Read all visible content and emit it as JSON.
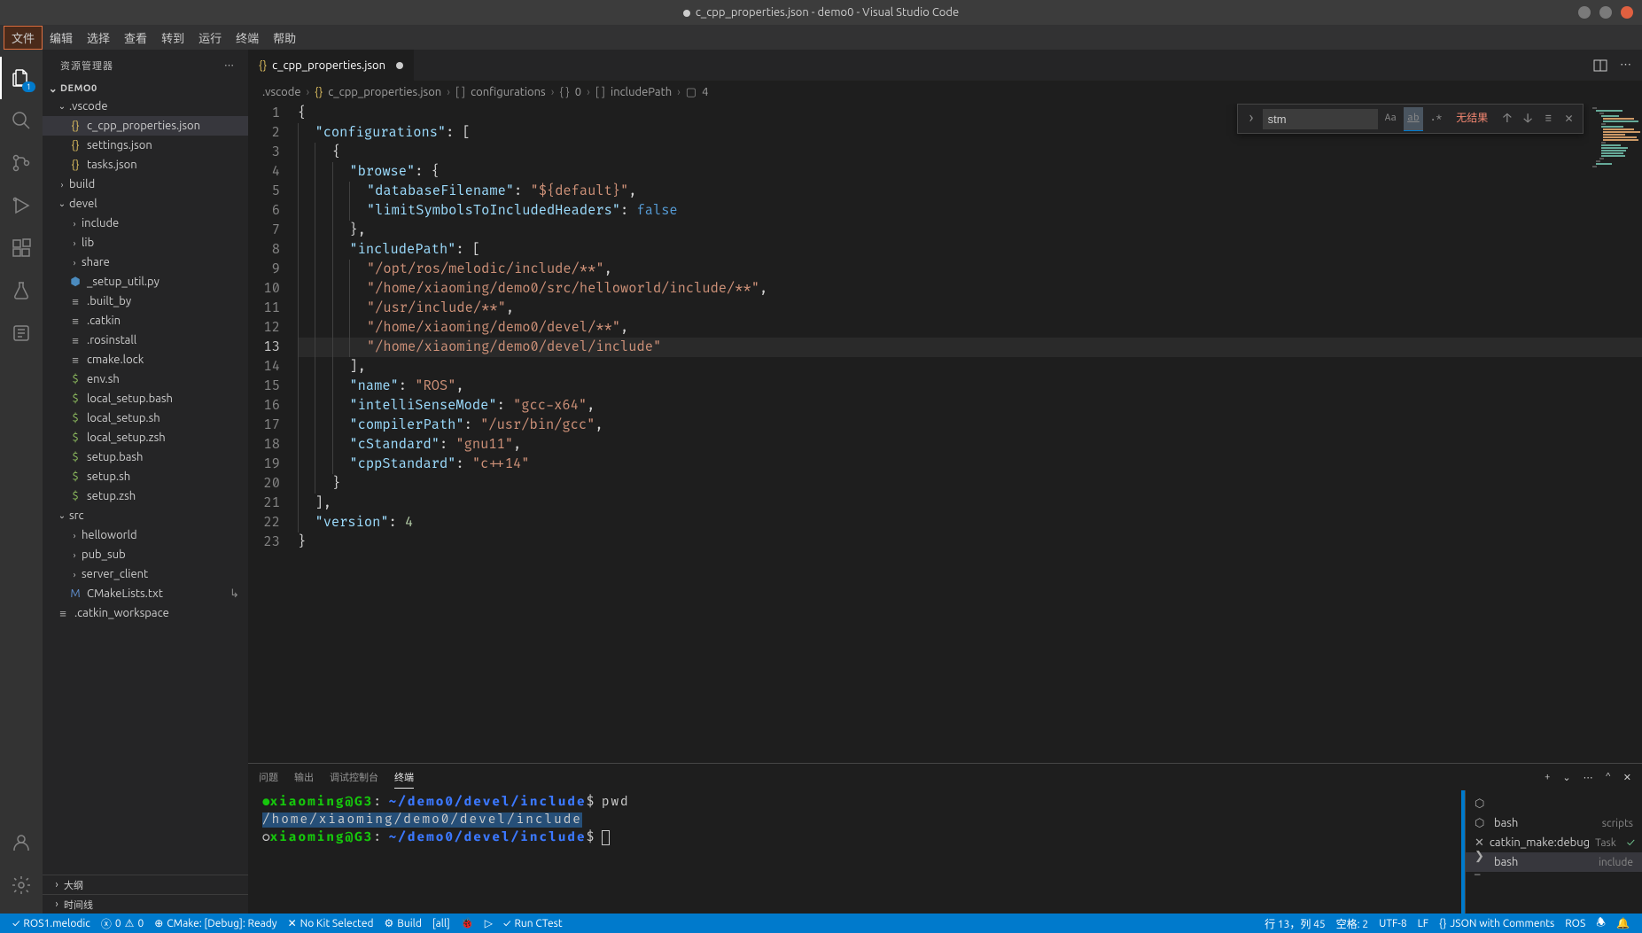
{
  "title": "c_cpp_properties.json - demo0 - Visual Studio Code",
  "menu": [
    "文件",
    "编辑",
    "选择",
    "查看",
    "转到",
    "运行",
    "终端",
    "帮助"
  ],
  "sidebar": {
    "title": "资源管理器",
    "project": "DEMO0",
    "outline": "大纲",
    "timeline": "时间线",
    "tree": {
      "vscode": ".vscode",
      "ccpp": "c_cpp_properties.json",
      "settings": "settings.json",
      "tasks": "tasks.json",
      "build": "build",
      "devel": "devel",
      "include": "include",
      "lib": "lib",
      "share": "share",
      "setup_util": "_setup_util.py",
      "built_by": ".built_by",
      "catkin": ".catkin",
      "rosinstall": ".rosinstall",
      "cmake_lock": "cmake.lock",
      "env_sh": "env.sh",
      "local_setup_bash": "local_setup.bash",
      "local_setup_sh": "local_setup.sh",
      "local_setup_zsh": "local_setup.zsh",
      "setup_bash": "setup.bash",
      "setup_sh": "setup.sh",
      "setup_zsh": "setup.zsh",
      "src": "src",
      "helloworld": "helloworld",
      "pub_sub": "pub_sub",
      "server_client": "server_client",
      "cmakelists": "CMakeLists.txt",
      "catkin_workspace": ".catkin_workspace"
    }
  },
  "tab": {
    "label": "c_cpp_properties.json"
  },
  "breadcrumbs": {
    "b1": ".vscode",
    "b2": "c_cpp_properties.json",
    "b3": "configurations",
    "b4": "0",
    "b5": "includePath",
    "b6": "4"
  },
  "find": {
    "value": "stm",
    "option_case": "Aa",
    "option_word": "ab",
    "option_regex": ".*",
    "result": "无结果"
  },
  "code": {
    "lines": [
      "{",
      "  \"configurations\": [",
      "    {",
      "      \"browse\": {",
      "        \"databaseFilename\": \"${default}\",",
      "        \"limitSymbolsToIncludedHeaders\": false",
      "      },",
      "      \"includePath\": [",
      "        \"/opt/ros/melodic/include/**\",",
      "        \"/home/xiaoming/demo0/src/helloworld/include/**\",",
      "        \"/usr/include/**\",",
      "        \"/home/xiaoming/demo0/devel/**\",",
      "        \"/home/xiaoming/demo0/devel/include\"",
      "      ],",
      "      \"name\": \"ROS\",",
      "      \"intelliSenseMode\": \"gcc-x64\",",
      "      \"compilerPath\": \"/usr/bin/gcc\",",
      "      \"cStandard\": \"gnu11\",",
      "      \"cppStandard\": \"c++14\"",
      "    }",
      "  ],",
      "  \"version\": 4",
      "}"
    ]
  },
  "terminal": {
    "tabs": {
      "problems": "问题",
      "output": "输出",
      "debug": "调试控制台",
      "terminal": "终端"
    },
    "prompt_user": "xiaoming@G3",
    "prompt_path": "~/demo0/devel/include",
    "cmd1": "pwd",
    "out1": "/home/xiaoming/demo0/devel/include",
    "side": {
      "bash_scripts": "bash",
      "bash_scripts_d": "scripts",
      "catkin": "catkin_make:debug",
      "catkin_d": "Task",
      "bash_include": "bash",
      "bash_include_d": "include"
    }
  },
  "status": {
    "ros": "ROS1.melodic",
    "errors": "0",
    "warnings": "0",
    "cmake": "CMake: [Debug]: Ready",
    "kit": "No Kit Selected",
    "build": "Build",
    "all": "[all]",
    "ctest": "Run CTest",
    "line_col": "行 13，列 45",
    "spaces": "空格: 2",
    "encoding": "UTF-8",
    "eol": "LF",
    "lang": "JSON with Comments",
    "ros_right": "ROS"
  }
}
